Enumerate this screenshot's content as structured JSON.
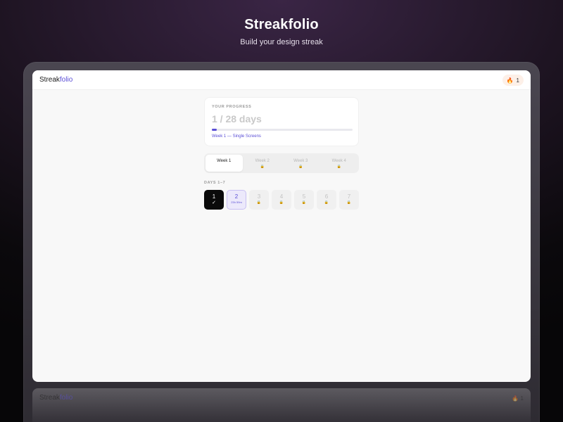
{
  "hero": {
    "title": "Streakfolio",
    "subtitle": "Build your design streak"
  },
  "app": {
    "brand_main": "Streak",
    "brand_accent": "folio",
    "streak_icon": "fire-icon",
    "streak_count": "1"
  },
  "progress": {
    "label": "YOUR PROGRESS",
    "days": "1 / 28 days",
    "fraction": 0.036,
    "caption": "Week 1 — Single Screens"
  },
  "weeks": [
    {
      "label": "Week 1",
      "locked": false,
      "active": true
    },
    {
      "label": "Week 2",
      "locked": true,
      "active": false,
      "lock_icon": "🔒"
    },
    {
      "label": "Week 3",
      "locked": true,
      "active": false,
      "lock_icon": "🔒"
    },
    {
      "label": "Week 4",
      "locked": true,
      "active": false,
      "lock_icon": "🔒"
    }
  ],
  "days_label": "DAYS 1–7",
  "days": [
    {
      "num": "1",
      "sub": "✓",
      "state": "done"
    },
    {
      "num": "2",
      "sub": "23h 59m",
      "state": "current"
    },
    {
      "num": "3",
      "sub": "🔒",
      "state": "locked"
    },
    {
      "num": "4",
      "sub": "🔒",
      "state": "locked"
    },
    {
      "num": "5",
      "sub": "🔒",
      "state": "locked"
    },
    {
      "num": "6",
      "sub": "🔒",
      "state": "locked"
    },
    {
      "num": "7",
      "sub": "🔒",
      "state": "locked"
    }
  ],
  "colors": {
    "accent": "#5b4fd6",
    "done": "#0a0a0a",
    "current_bg": "#ece9fb",
    "lock": "#d3b03a",
    "streak_pill": "#fdf0e8"
  }
}
